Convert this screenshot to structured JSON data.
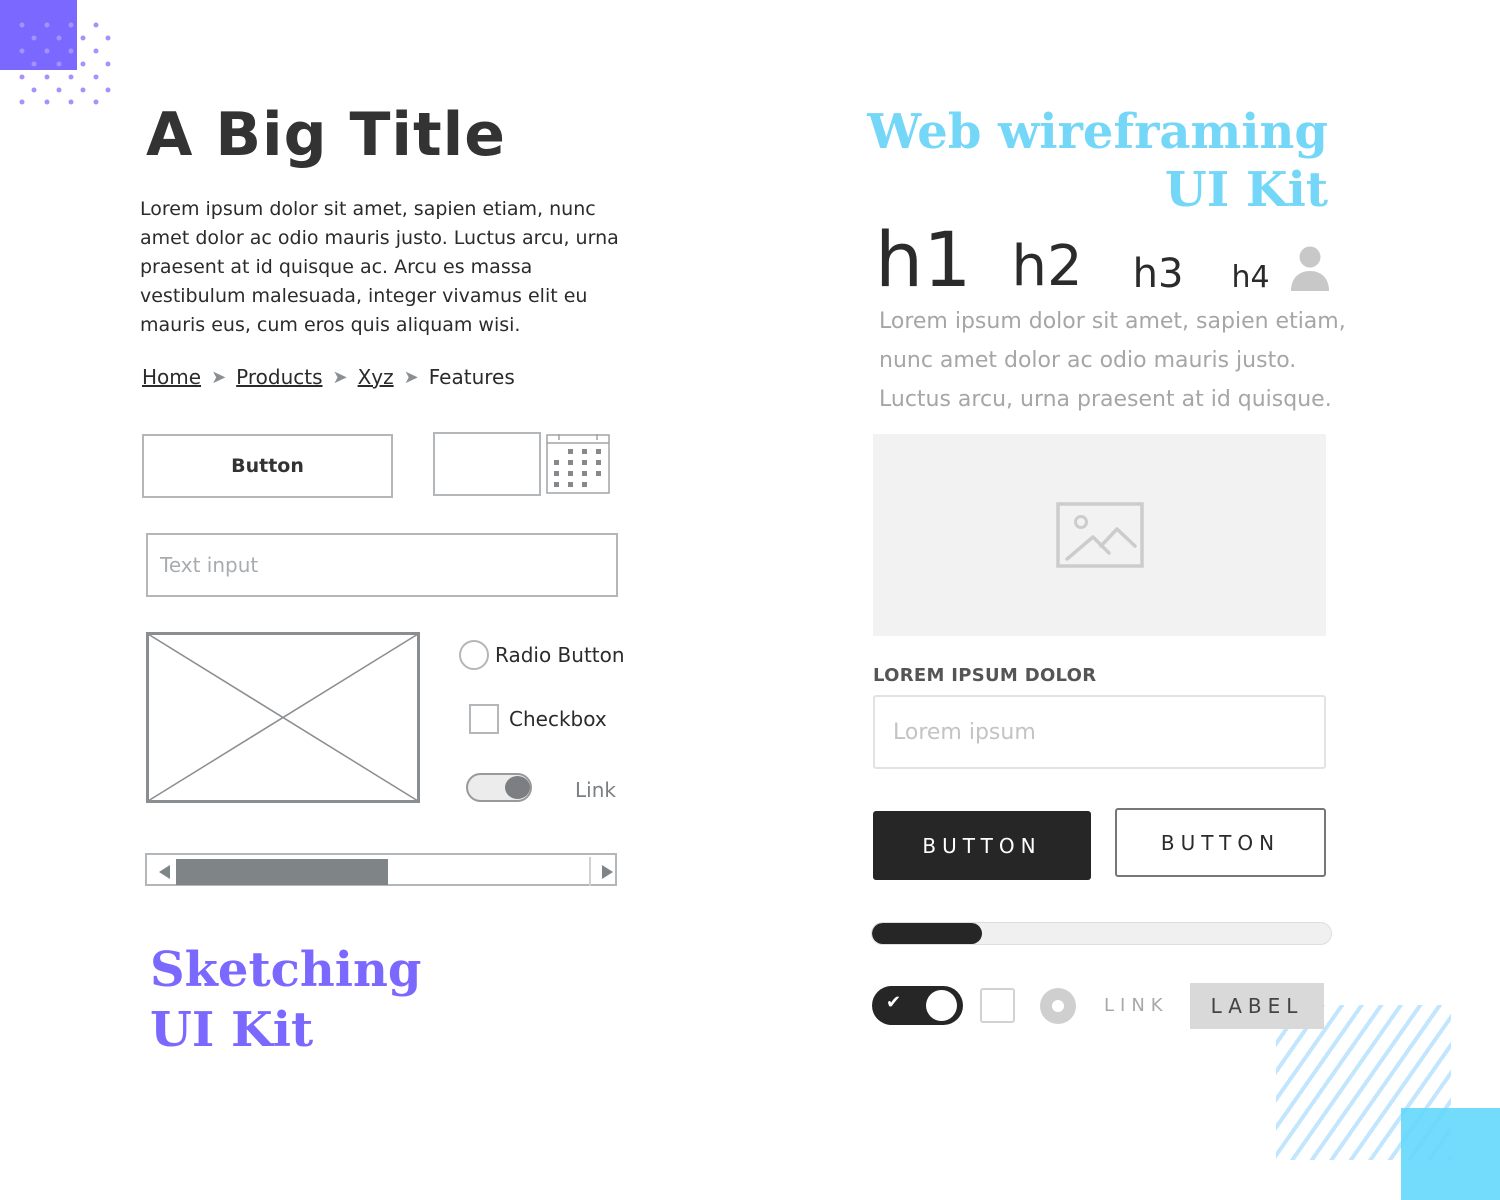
{
  "sketch": {
    "title": "A Big Title",
    "paragraph": "Lorem ipsum dolor sit amet, sapien etiam, nunc amet dolor ac odio mauris justo. Luctus arcu, urna praesent at id quisque ac. Arcu es massa vestibulum malesuada, integer vivamus elit eu mauris eus, cum eros quis aliquam wisi.",
    "breadcrumb": [
      {
        "label": "Home",
        "link": true
      },
      {
        "label": "Products",
        "link": true
      },
      {
        "label": "Xyz",
        "link": true
      },
      {
        "label": "Features",
        "link": false
      }
    ],
    "breadcrumb_separator": "chevron-right-icon",
    "button_label": "Button",
    "date_input_value": "",
    "text_input_placeholder": "Text input",
    "radio_label": "Radio Button",
    "radio_checked": false,
    "checkbox_label": "Checkbox",
    "checkbox_checked": false,
    "toggle_on": true,
    "link_label": "Link",
    "scrollbar_thumb_fraction": 0.48,
    "kit_title_line1": "Sketching",
    "kit_title_line2": "UI Kit"
  },
  "web": {
    "kit_title_line1": "Web wireframing",
    "kit_title_line2": "UI Kit",
    "headings": [
      "h1",
      "h2",
      "h3",
      "h4"
    ],
    "paragraph": "Lorem ipsum dolor sit amet, sapien etiam, nunc amet dolor ac odio mauris justo. Luctus arcu, urna praesent at id quisque.",
    "field_label": "LOREM IPSUM DOLOR",
    "input_placeholder": "Lorem ipsum",
    "button_primary": "BUTTON",
    "button_secondary": "BUTTON",
    "progress_percent": 24,
    "toggle_on": true,
    "checkbox_checked": false,
    "radio_checked": true,
    "link_label": "LINK",
    "label_text": "LABEL"
  },
  "colors": {
    "sketch_accent": "#7b68ff",
    "web_accent": "#74d7f7",
    "dark": "#262626"
  }
}
